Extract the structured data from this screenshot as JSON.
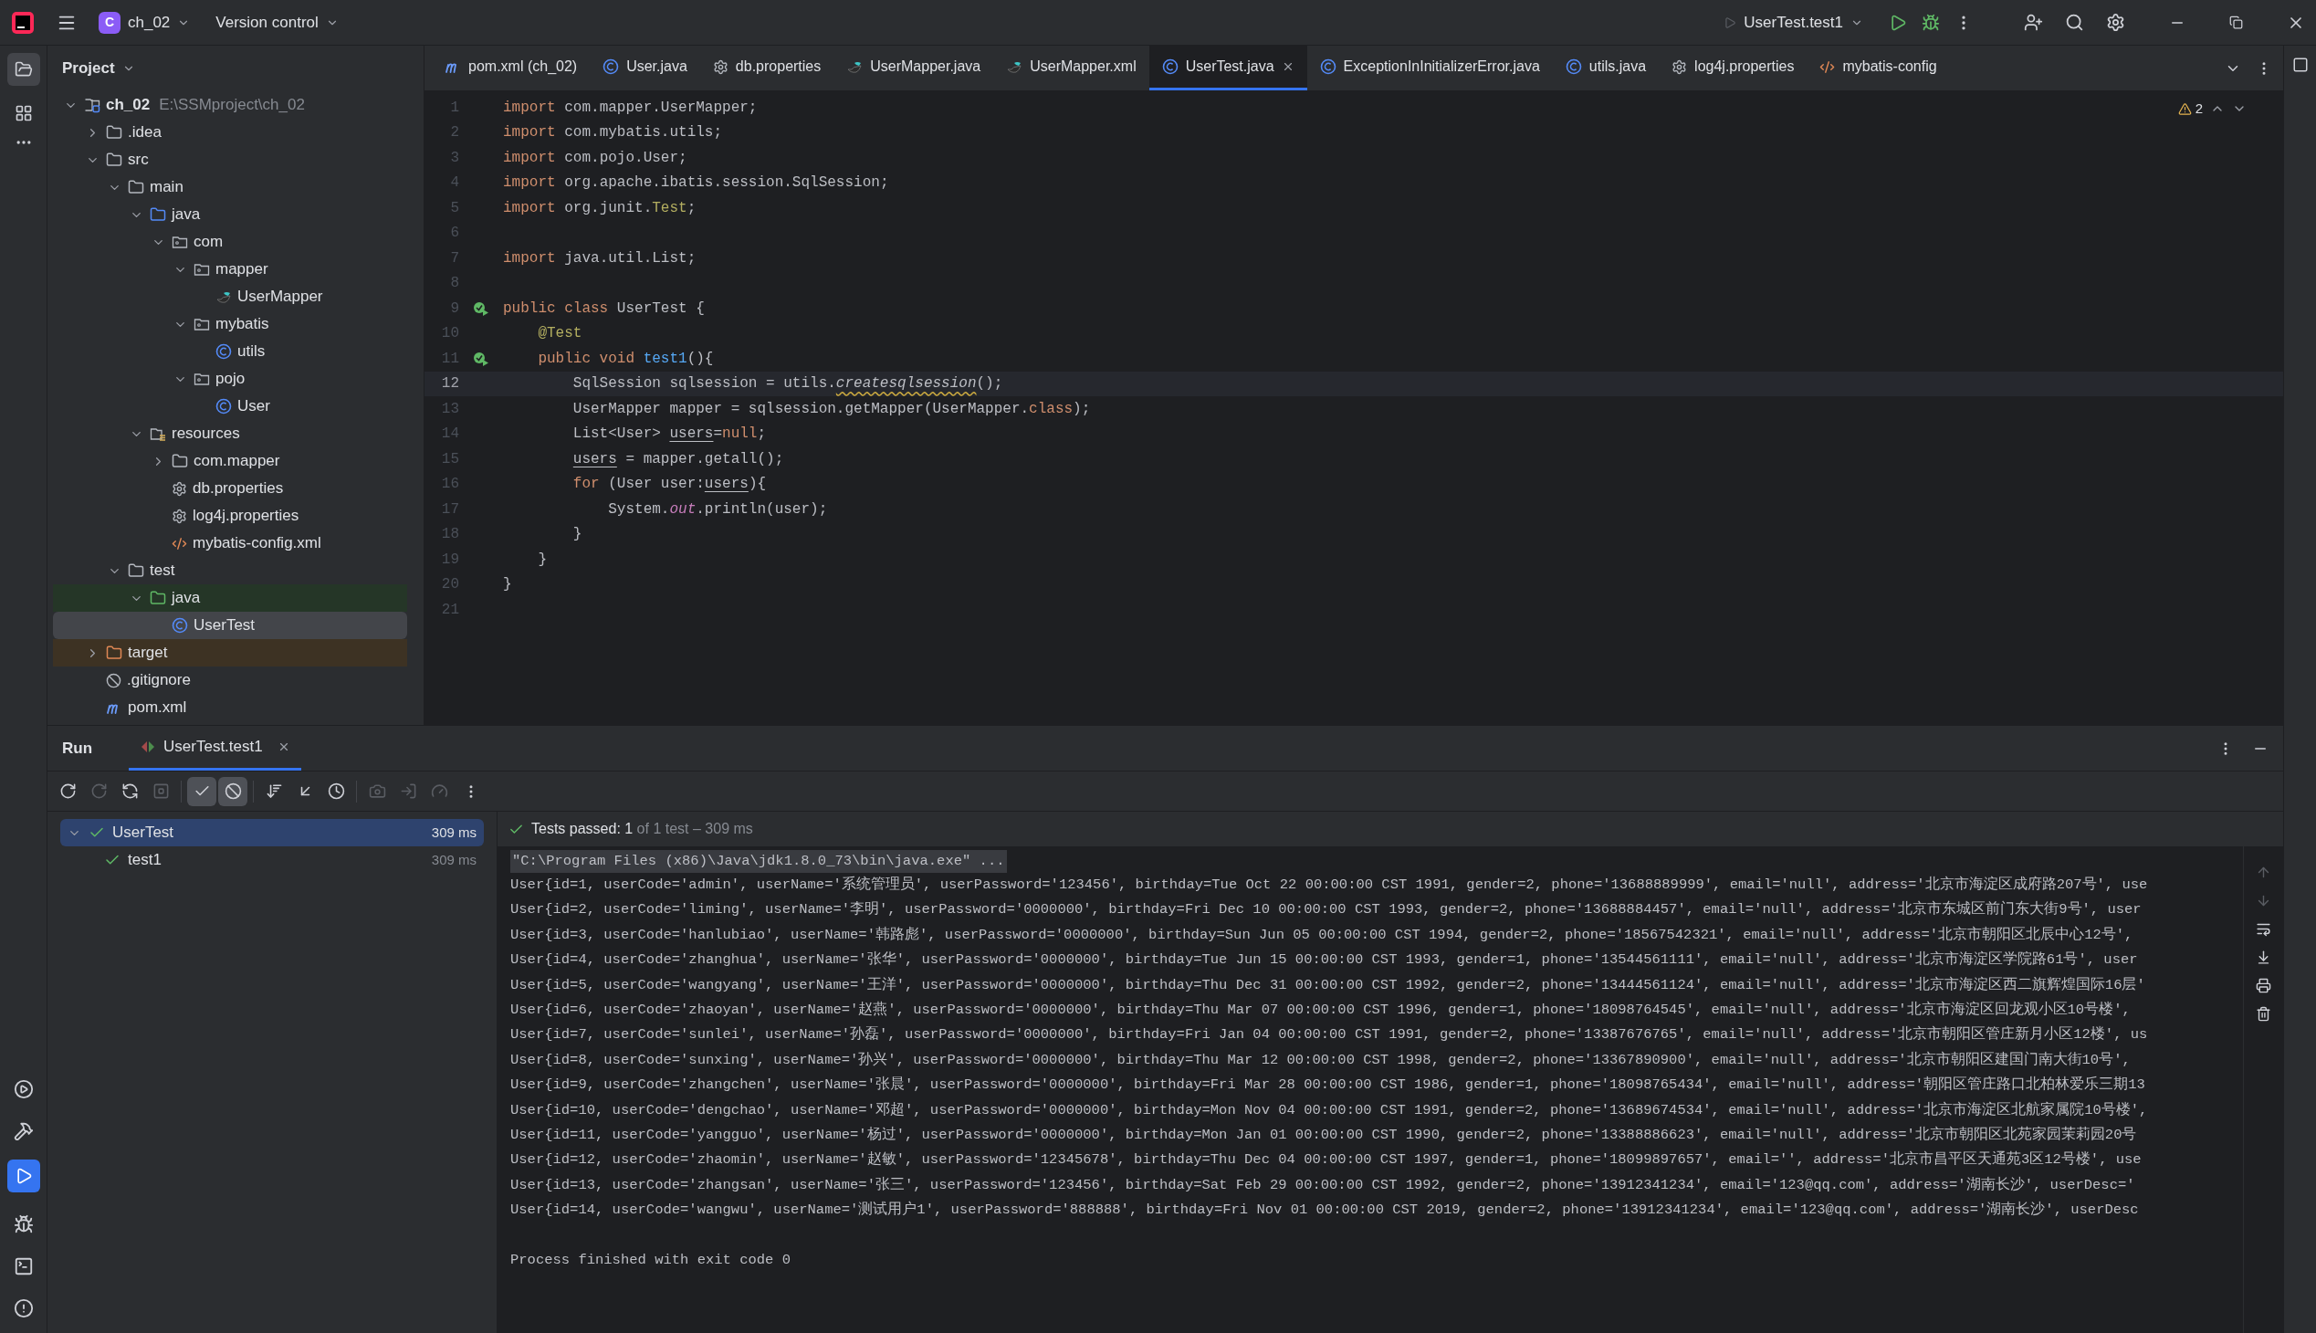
{
  "title_bar": {
    "project_badge": "C",
    "project": "ch_02",
    "vcs": "Version control",
    "run_config": "UserTest.test1"
  },
  "project_panel": {
    "title": "Project",
    "tree": [
      {
        "label": "ch_02",
        "hint": "E:\\SSMproject\\ch_02",
        "kind": "module",
        "expanded": true,
        "selected": false,
        "children": [
          {
            "label": ".idea",
            "kind": "folder",
            "expanded": false,
            "selected": false
          },
          {
            "label": "src",
            "kind": "folder",
            "expanded": true,
            "selected": false,
            "children": [
              {
                "label": "main",
                "kind": "folder",
                "expanded": true,
                "selected": false,
                "children": [
                  {
                    "label": "java",
                    "kind": "source",
                    "expanded": true,
                    "selected": false,
                    "children": [
                      {
                        "label": "com",
                        "kind": "package",
                        "expanded": true,
                        "selected": false,
                        "children": [
                          {
                            "label": "mapper",
                            "kind": "package",
                            "expanded": true,
                            "selected": false,
                            "children": [
                              {
                                "label": "UserMapper",
                                "kind": "mapper",
                                "selected": false
                              }
                            ]
                          },
                          {
                            "label": "mybatis",
                            "kind": "package",
                            "expanded": true,
                            "selected": false,
                            "children": [
                              {
                                "label": "utils",
                                "kind": "class",
                                "selected": false
                              }
                            ]
                          },
                          {
                            "label": "pojo",
                            "kind": "package",
                            "expanded": true,
                            "selected": false,
                            "children": [
                              {
                                "label": "User",
                                "kind": "class",
                                "selected": false
                              }
                            ]
                          }
                        ]
                      }
                    ]
                  },
                  {
                    "label": "resources",
                    "kind": "resources",
                    "expanded": true,
                    "selected": false,
                    "children": [
                      {
                        "label": "com.mapper",
                        "kind": "folder",
                        "expanded": false,
                        "selected": false
                      },
                      {
                        "label": "db.properties",
                        "kind": "settings",
                        "selected": false
                      },
                      {
                        "label": "log4j.properties",
                        "kind": "settings",
                        "selected": false
                      },
                      {
                        "label": "mybatis-config.xml",
                        "kind": "xml",
                        "selected": false
                      }
                    ]
                  }
                ]
              },
              {
                "label": "test",
                "kind": "folder",
                "expanded": true,
                "selected": false,
                "children": [
                  {
                    "label": "java",
                    "kind": "test-source",
                    "expanded": true,
                    "selected": false,
                    "children": [
                      {
                        "label": "UserTest",
                        "kind": "class",
                        "selected": true
                      }
                    ]
                  }
                ]
              }
            ]
          },
          {
            "label": "target",
            "kind": "excluded",
            "expanded": false,
            "selected": false
          },
          {
            "label": ".gitignore",
            "kind": "ignore",
            "selected": false
          },
          {
            "label": "pom.xml",
            "kind": "maven",
            "selected": false
          }
        ]
      }
    ]
  },
  "editor": {
    "tabs": [
      {
        "label": "pom.xml (ch_02)",
        "kind": "maven",
        "selected": false
      },
      {
        "label": "User.java",
        "kind": "class",
        "selected": false
      },
      {
        "label": "db.properties",
        "kind": "settings",
        "selected": false
      },
      {
        "label": "UserMapper.java",
        "kind": "mapper",
        "selected": false
      },
      {
        "label": "UserMapper.xml",
        "kind": "mapper",
        "selected": false
      },
      {
        "label": "UserTest.java",
        "kind": "class",
        "selected": true
      },
      {
        "label": "ExceptionInInitializerError.java",
        "kind": "class",
        "selected": false
      },
      {
        "label": "utils.java",
        "kind": "class",
        "selected": false
      },
      {
        "label": "log4j.properties",
        "kind": "settings",
        "selected": false
      },
      {
        "label": "mybatis-config",
        "kind": "xml",
        "selected": false
      }
    ],
    "warnings": "2",
    "lines": [
      {
        "number": "1",
        "tokens": [
          {
            "text": "import",
            "kind": "kw"
          },
          {
            "text": " com.mapper.UserMapper;",
            "kind": "plain"
          }
        ]
      },
      {
        "number": "2",
        "tokens": [
          {
            "text": "import",
            "kind": "kw"
          },
          {
            "text": " com.mybatis.utils;",
            "kind": "plain"
          }
        ]
      },
      {
        "number": "3",
        "tokens": [
          {
            "text": "import",
            "kind": "kw"
          },
          {
            "text": " com.pojo.User;",
            "kind": "plain"
          }
        ]
      },
      {
        "number": "4",
        "tokens": [
          {
            "text": "import",
            "kind": "kw"
          },
          {
            "text": " org.apache.ibatis.session.SqlSession;",
            "kind": "plain"
          }
        ]
      },
      {
        "number": "5",
        "tokens": [
          {
            "text": "import",
            "kind": "kw"
          },
          {
            "text": " org.junit.",
            "kind": "plain"
          },
          {
            "text": "Test",
            "kind": "ann"
          },
          {
            "text": ";",
            "kind": "plain"
          }
        ]
      },
      {
        "number": "6"
      },
      {
        "number": "7",
        "tokens": [
          {
            "text": "import",
            "kind": "kw"
          },
          {
            "text": " java.util.List;",
            "kind": "plain"
          }
        ]
      },
      {
        "number": "8"
      },
      {
        "number": "9",
        "run_marker": true,
        "tokens": [
          {
            "text": "public class",
            "kind": "kw"
          },
          {
            "text": " UserTest {",
            "kind": "plain"
          }
        ]
      },
      {
        "number": "10",
        "tokens": [
          {
            "text": "    @Test",
            "kind": "ann"
          }
        ]
      },
      {
        "number": "11",
        "run_marker": true,
        "tokens": [
          {
            "text": "    public void",
            "kind": "kw"
          },
          {
            "text": " test1",
            "kind": "fn"
          },
          {
            "text": "(){",
            "kind": "plain"
          }
        ]
      },
      {
        "number": "12",
        "current": true,
        "tokens": [
          {
            "text": "        SqlSession sqlsession = utils.",
            "kind": "plain"
          },
          {
            "text": "createsqlsession",
            "kind": "wavy"
          },
          {
            "text": "();",
            "kind": "plain"
          }
        ]
      },
      {
        "number": "13",
        "tokens": [
          {
            "text": "        UserMapper mapper = sqlsession.getMapper(UserMapper.",
            "kind": "plain"
          },
          {
            "text": "class",
            "kind": "kw"
          },
          {
            "text": ");",
            "kind": "plain"
          }
        ]
      },
      {
        "number": "14",
        "tokens": [
          {
            "text": "        List<User> ",
            "kind": "plain"
          },
          {
            "text": "users",
            "kind": "under"
          },
          {
            "text": "=",
            "kind": "plain"
          },
          {
            "text": "null",
            "kind": "kw"
          },
          {
            "text": ";",
            "kind": "plain"
          }
        ]
      },
      {
        "number": "15",
        "tokens": [
          {
            "text": "        users",
            "kind": "under"
          },
          {
            "text": " = mapper.getall();",
            "kind": "plain"
          }
        ]
      },
      {
        "number": "16",
        "tokens": [
          {
            "text": "        for",
            "kind": "kw"
          },
          {
            "text": " (User user:",
            "kind": "plain"
          },
          {
            "text": "users",
            "kind": "under"
          },
          {
            "text": "){",
            "kind": "plain"
          }
        ]
      },
      {
        "number": "17",
        "tokens": [
          {
            "text": "            System.",
            "kind": "plain"
          },
          {
            "text": "out",
            "kind": "static"
          },
          {
            "text": ".println(user);",
            "kind": "plain"
          }
        ]
      },
      {
        "number": "18",
        "tokens": [
          {
            "text": "        }",
            "kind": "plain"
          }
        ]
      },
      {
        "number": "19",
        "tokens": [
          {
            "text": "    }",
            "kind": "plain"
          }
        ]
      },
      {
        "number": "20",
        "tokens": [
          {
            "text": "}",
            "kind": "plain"
          }
        ]
      },
      {
        "number": "21"
      }
    ]
  },
  "run_panel": {
    "title": "Run",
    "tabs": [
      {
        "label": "UserTest.test1",
        "selected": true
      }
    ],
    "toolbar": [
      {
        "kind": "rerun",
        "disabled": false,
        "on": false
      },
      {
        "kind": "rerun-failed",
        "disabled": true,
        "on": false
      },
      {
        "kind": "auto",
        "disabled": false,
        "on": false
      },
      {
        "kind": "stop",
        "disabled": true,
        "on": false
      },
      {
        "kind": "passed",
        "disabled": false,
        "on": true
      },
      {
        "kind": "ignored",
        "disabled": false,
        "on": true
      },
      {
        "kind": "sort",
        "disabled": false,
        "on": false
      },
      {
        "kind": "collapse",
        "disabled": false,
        "on": false
      },
      {
        "kind": "history",
        "disabled": false,
        "on": false
      },
      {
        "kind": "camera",
        "disabled": true,
        "on": false
      },
      {
        "kind": "import",
        "disabled": true,
        "on": false
      },
      {
        "kind": "gauge",
        "disabled": true,
        "on": false
      }
    ],
    "tests": [
      {
        "label": "UserTest",
        "time": "309 ms",
        "selected": true,
        "expanded": true,
        "children": [
          {
            "label": "test1",
            "time": "309 ms",
            "selected": false
          }
        ]
      }
    ],
    "status": {
      "passed": "Tests passed: 1",
      "detail": " of 1 test – 309 ms"
    },
    "command": "\"C:\\Program Files (x86)\\Java\\jdk1.8.0_73\\bin\\java.exe\" ...",
    "output": [
      "User{id=1, userCode='admin', userName='系统管理员', userPassword='123456', birthday=Tue Oct 22 00:00:00 CST 1991, gender=2, phone='13688889999', email='null', address='北京市海淀区成府路207号', use",
      "User{id=2, userCode='liming', userName='李明', userPassword='0000000', birthday=Fri Dec 10 00:00:00 CST 1993, gender=2, phone='13688884457', email='null', address='北京市东城区前门东大街9号', user",
      "User{id=3, userCode='hanlubiao', userName='韩路彪', userPassword='0000000', birthday=Sun Jun 05 00:00:00 CST 1994, gender=2, phone='18567542321', email='null', address='北京市朝阳区北辰中心12号',",
      "User{id=4, userCode='zhanghua', userName='张华', userPassword='0000000', birthday=Tue Jun 15 00:00:00 CST 1993, gender=1, phone='13544561111', email='null', address='北京市海淀区学院路61号', user",
      "User{id=5, userCode='wangyang', userName='王洋', userPassword='0000000', birthday=Thu Dec 31 00:00:00 CST 1992, gender=2, phone='13444561124', email='null', address='北京市海淀区西二旗辉煌国际16层'",
      "User{id=6, userCode='zhaoyan', userName='赵燕', userPassword='0000000', birthday=Thu Mar 07 00:00:00 CST 1996, gender=1, phone='18098764545', email='null', address='北京市海淀区回龙观小区10号楼',",
      "User{id=7, userCode='sunlei', userName='孙磊', userPassword='0000000', birthday=Fri Jan 04 00:00:00 CST 1991, gender=2, phone='13387676765', email='null', address='北京市朝阳区管庄新月小区12楼', us",
      "User{id=8, userCode='sunxing', userName='孙兴', userPassword='0000000', birthday=Thu Mar 12 00:00:00 CST 1998, gender=2, phone='13367890900', email='null', address='北京市朝阳区建国门南大街10号',",
      "User{id=9, userCode='zhangchen', userName='张晨', userPassword='0000000', birthday=Fri Mar 28 00:00:00 CST 1986, gender=1, phone='18098765434', email='null', address='朝阳区管庄路口北柏林爱乐三期13",
      "User{id=10, userCode='dengchao', userName='邓超', userPassword='0000000', birthday=Mon Nov 04 00:00:00 CST 1991, gender=2, phone='13689674534', email='null', address='北京市海淀区北航家属院10号楼',",
      "User{id=11, userCode='yangguo', userName='杨过', userPassword='0000000', birthday=Mon Jan 01 00:00:00 CST 1990, gender=2, phone='13388886623', email='null', address='北京市朝阳区北苑家园茉莉园20号",
      "User{id=12, userCode='zhaomin', userName='赵敏', userPassword='12345678', birthday=Thu Dec 04 00:00:00 CST 1997, gender=1, phone='18099897657', email='', address='北京市昌平区天通苑3区12号楼', use",
      "User{id=13, userCode='zhangsan', userName='张三', userPassword='123456', birthday=Sat Feb 29 00:00:00 CST 1992, gender=2, phone='13912341234', email='123@qq.com', address='湖南长沙', userDesc='",
      "User{id=14, userCode='wangwu', userName='测试用户1', userPassword='888888', birthday=Fri Nov 01 00:00:00 CST 2019, gender=2, phone='13912341234', email='123@qq.com', address='湖南长沙', userDesc"
    ],
    "exit": "Process finished with exit code 0"
  }
}
